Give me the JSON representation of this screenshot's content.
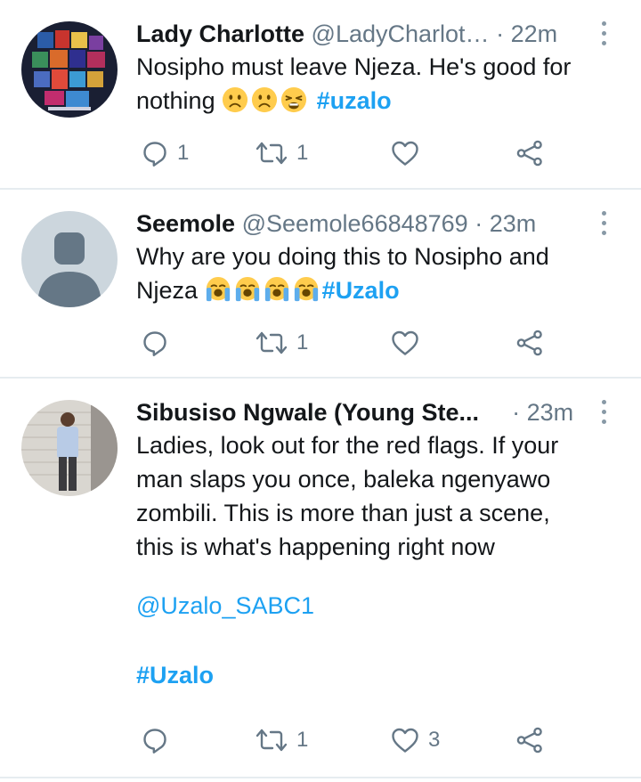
{
  "tweets": [
    {
      "name": "Lady Charlotte",
      "handle": "@LadyCharlot…",
      "sep": "·",
      "time": "22m",
      "text_lines": [
        "Nosipho must leave Njeza. He's good for",
        "nothing"
      ],
      "emoji": [
        "slightly-frowning-face",
        "slightly-frowning-face",
        "weary-face"
      ],
      "hashtag": "#uzalo",
      "reply_count": "1",
      "retweet_count": "1",
      "like_count": ""
    },
    {
      "name": "Seemole",
      "handle": "@Seemole66848769",
      "sep": "·",
      "time": "23m",
      "text_lines": [
        "Why are you doing this to Nosipho and",
        "Njeza"
      ],
      "emoji": [
        "loudly-crying-face",
        "loudly-crying-face",
        "loudly-crying-face",
        "loudly-crying-face"
      ],
      "hashtag": "#Uzalo",
      "reply_count": "",
      "retweet_count": "1",
      "like_count": ""
    },
    {
      "name": "Sibusiso Ngwale (Young Ste...",
      "handle": "",
      "sep": "·",
      "time": "23m",
      "text_lines": [
        "Ladies, look out for the red flags. If your",
        "man slaps you once, baleka ngenyawo",
        "zombili. This is more than just a scene,",
        "this is what's happening right now"
      ],
      "mention": "@Uzalo_SABC1",
      "hashtag": "#Uzalo",
      "reply_count": "",
      "retweet_count": "1",
      "like_count": "3"
    }
  ],
  "icons": {
    "reply": "reply-icon",
    "retweet": "retweet-icon",
    "like": "heart-icon",
    "share": "share-icon",
    "more": "more-vertical-icon"
  },
  "colors": {
    "link": "#1da1f2",
    "secondary": "#657786",
    "divider": "#e6ecf0",
    "text": "#14171a"
  }
}
